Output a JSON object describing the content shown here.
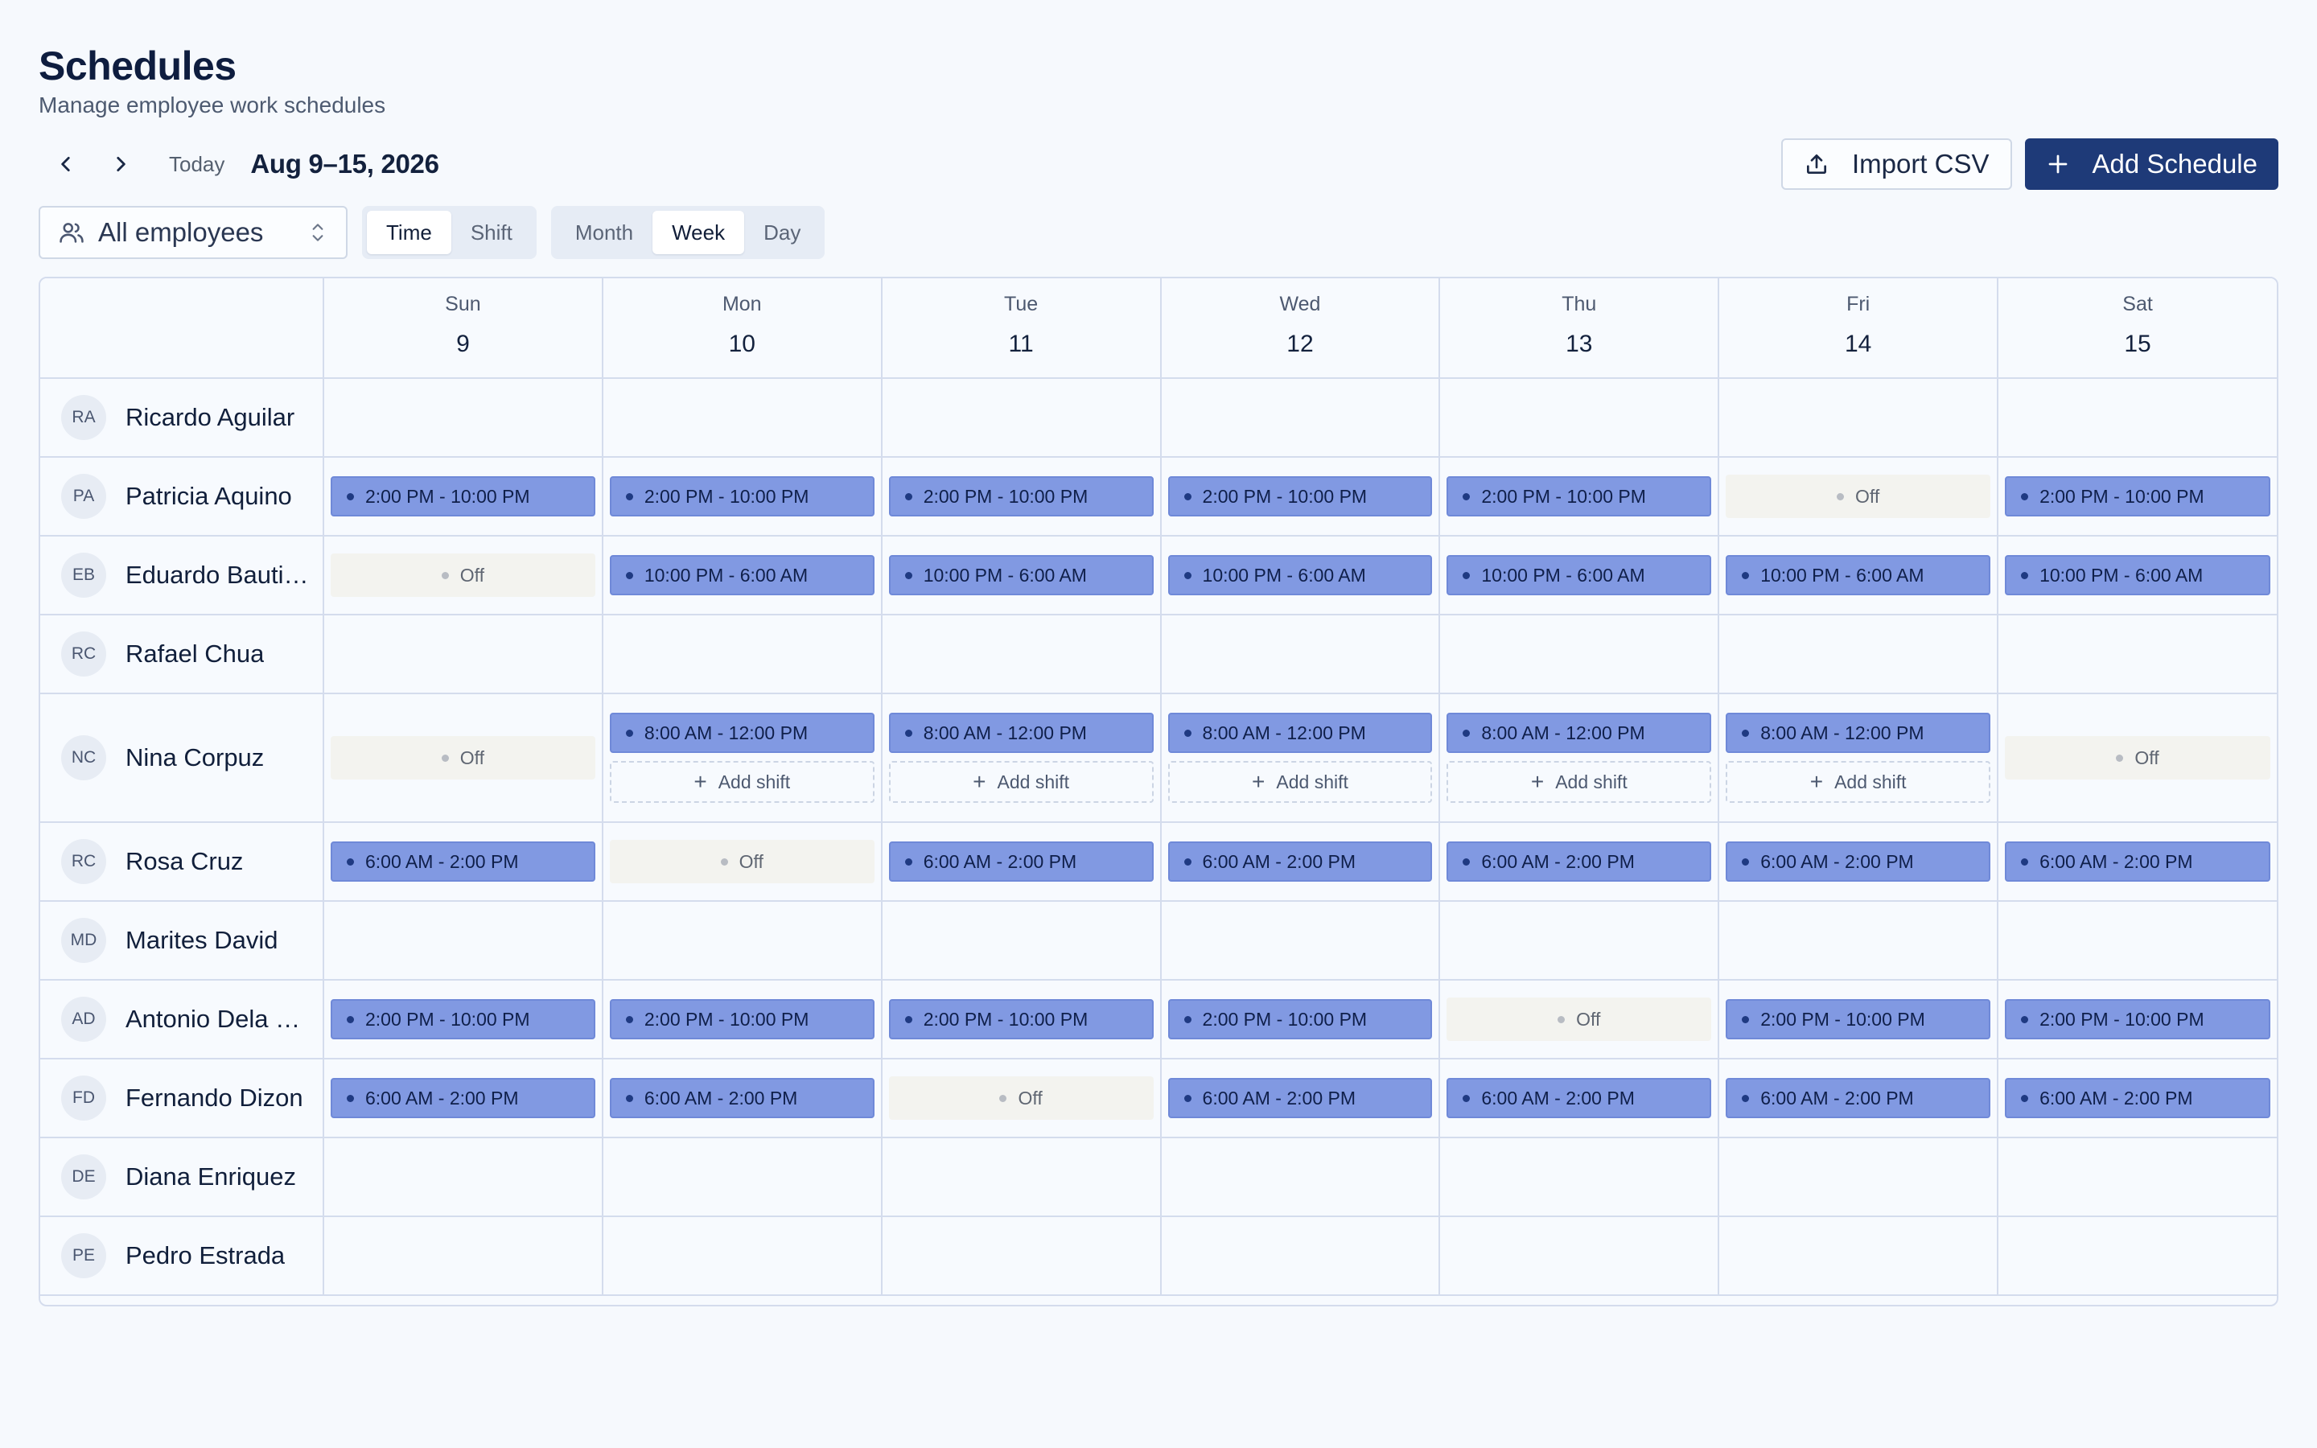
{
  "header": {
    "title": "Schedules",
    "subtitle": "Manage employee work schedules"
  },
  "toolbar": {
    "prev_icon": "chevron-left-icon",
    "next_icon": "chevron-right-icon",
    "today_label": "Today",
    "date_range": "Aug 9–15, 2026",
    "import_label": "Import CSV",
    "import_icon": "upload-icon",
    "add_label": "Add Schedule",
    "add_icon": "plus-icon",
    "primary_color": "#1e3a78"
  },
  "filters": {
    "employee_select": "All employees",
    "mode_options": [
      "Time",
      "Shift"
    ],
    "mode_selected": "Time",
    "view_options": [
      "Month",
      "Week",
      "Day"
    ],
    "view_selected": "Week"
  },
  "days": [
    {
      "name": "Sun",
      "num": "9"
    },
    {
      "name": "Mon",
      "num": "10"
    },
    {
      "name": "Tue",
      "num": "11"
    },
    {
      "name": "Wed",
      "num": "12"
    },
    {
      "name": "Thu",
      "num": "13"
    },
    {
      "name": "Fri",
      "num": "14"
    },
    {
      "name": "Sat",
      "num": "15"
    }
  ],
  "labels": {
    "off": "Off",
    "add_shift": "Add shift"
  },
  "colors": {
    "shift_fill": "#8199e2",
    "off_fill": "#f3f3ef"
  },
  "employees": [
    {
      "initials": "RA",
      "name": "Ricardo Aguilar",
      "cells": [
        null,
        null,
        null,
        null,
        null,
        null,
        null
      ]
    },
    {
      "initials": "PA",
      "name": "Patricia Aquino",
      "cells": [
        "2:00 PM - 10:00 PM",
        "2:00 PM - 10:00 PM",
        "2:00 PM - 10:00 PM",
        "2:00 PM - 10:00 PM",
        "2:00 PM - 10:00 PM",
        "Off",
        "2:00 PM - 10:00 PM"
      ]
    },
    {
      "initials": "EB",
      "name": "Eduardo Bautis...",
      "cells": [
        "Off",
        "10:00 PM - 6:00 AM",
        "10:00 PM - 6:00 AM",
        "10:00 PM - 6:00 AM",
        "10:00 PM - 6:00 AM",
        "10:00 PM - 6:00 AM",
        "10:00 PM - 6:00 AM"
      ]
    },
    {
      "initials": "RC",
      "name": "Rafael Chua",
      "cells": [
        null,
        null,
        null,
        null,
        null,
        null,
        null
      ]
    },
    {
      "initials": "NC",
      "name": "Nina Corpuz",
      "tall": true,
      "cells": [
        "Off",
        "8:00 AM - 12:00 PM",
        "8:00 AM - 12:00 PM",
        "8:00 AM - 12:00 PM",
        "8:00 AM - 12:00 PM",
        "8:00 AM - 12:00 PM",
        "Off"
      ],
      "add_shift_days": [
        1,
        2,
        3,
        4,
        5
      ]
    },
    {
      "initials": "RC",
      "name": "Rosa Cruz",
      "cells": [
        "6:00 AM - 2:00 PM",
        "Off",
        "6:00 AM - 2:00 PM",
        "6:00 AM - 2:00 PM",
        "6:00 AM - 2:00 PM",
        "6:00 AM - 2:00 PM",
        "6:00 AM - 2:00 PM"
      ]
    },
    {
      "initials": "MD",
      "name": "Marites David",
      "cells": [
        null,
        null,
        null,
        null,
        null,
        null,
        null
      ]
    },
    {
      "initials": "AD",
      "name": "Antonio Dela C...",
      "cells": [
        "2:00 PM - 10:00 PM",
        "2:00 PM - 10:00 PM",
        "2:00 PM - 10:00 PM",
        "2:00 PM - 10:00 PM",
        "Off",
        "2:00 PM - 10:00 PM",
        "2:00 PM - 10:00 PM"
      ]
    },
    {
      "initials": "FD",
      "name": "Fernando Dizon",
      "cells": [
        "6:00 AM - 2:00 PM",
        "6:00 AM - 2:00 PM",
        "Off",
        "6:00 AM - 2:00 PM",
        "6:00 AM - 2:00 PM",
        "6:00 AM - 2:00 PM",
        "6:00 AM - 2:00 PM"
      ]
    },
    {
      "initials": "DE",
      "name": "Diana Enriquez",
      "cells": [
        null,
        null,
        null,
        null,
        null,
        null,
        null
      ]
    },
    {
      "initials": "PE",
      "name": "Pedro Estrada",
      "cells": [
        null,
        null,
        null,
        null,
        null,
        null,
        null
      ]
    }
  ]
}
